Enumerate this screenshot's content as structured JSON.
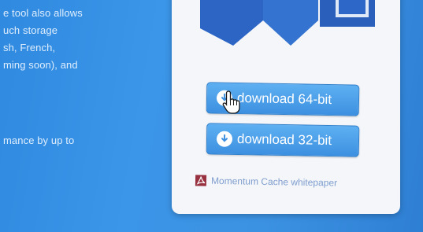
{
  "left_copy": {
    "line1": "e tool also allows",
    "line2": "uch storage",
    "line3": "sh, French,",
    "line4": "ming soon), and",
    "line5": "mance by up to"
  },
  "buttons": {
    "download_64": "download 64-bit",
    "download_32": "download 32-bit"
  },
  "whitepaper_link": "Momentum Cache whitepaper",
  "colors": {
    "background": "#3b95e8",
    "card": "#f4f6fa",
    "button": "#4a9ee8",
    "logo": "#2c65c4",
    "link": "#6b8fc7",
    "pdf_icon": "#8a1020"
  },
  "icons": {
    "download": "download-circle-icon",
    "pdf": "pdf-icon",
    "cursor": "hand-pointer-cursor"
  }
}
